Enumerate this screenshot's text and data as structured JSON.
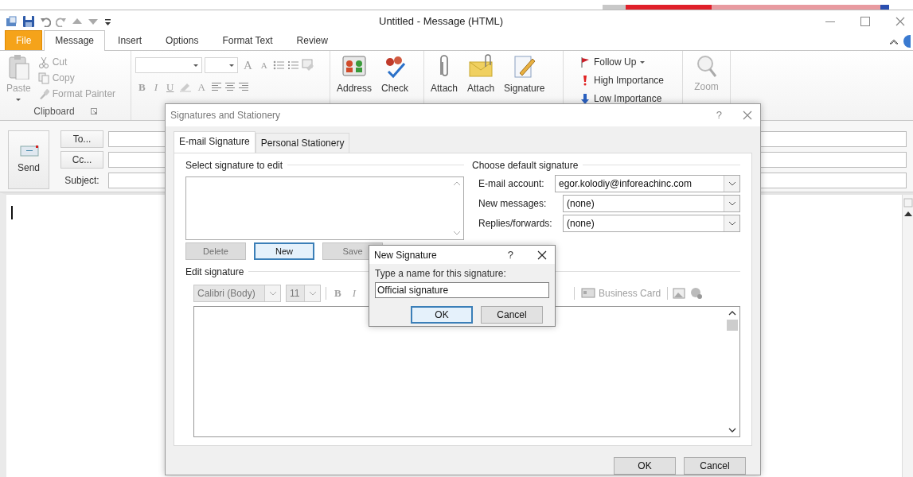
{
  "window": {
    "title": "Untitled - Message (HTML)"
  },
  "ribbon_tabs": [
    {
      "label": "File",
      "kind": "file",
      "selected": false
    },
    {
      "label": "Message",
      "kind": "tab",
      "selected": true
    },
    {
      "label": "Insert",
      "kind": "tab",
      "selected": false
    },
    {
      "label": "Options",
      "kind": "tab",
      "selected": false
    },
    {
      "label": "Format Text",
      "kind": "tab",
      "selected": false
    },
    {
      "label": "Review",
      "kind": "tab",
      "selected": false
    }
  ],
  "clipboard": {
    "paste": "Paste",
    "label": "Clipboard",
    "disabled": true,
    "items": [
      {
        "label": "Cut",
        "kind": "cut"
      },
      {
        "label": "Copy",
        "kind": "copy"
      },
      {
        "label": "Format Painter",
        "kind": "painter"
      }
    ]
  },
  "basic_text": {
    "grow": "A",
    "shrink": "A",
    "styles": [
      "B",
      "I",
      "U"
    ],
    "font_color": "A",
    "disabled": true
  },
  "big_buttons": [
    {
      "label": "Address",
      "kind": "address-book"
    },
    {
      "label": "Check",
      "kind": "check-names"
    },
    {
      "label": "Attach",
      "kind": "attach-file"
    },
    {
      "label": "Attach",
      "kind": "attach-item"
    },
    {
      "label": "Signature",
      "kind": "signature"
    }
  ],
  "tags": [
    {
      "label": "Follow Up",
      "kind": "flag"
    },
    {
      "label": "High Importance",
      "kind": "high"
    },
    {
      "label": "Low Importance",
      "kind": "low"
    }
  ],
  "zoom": {
    "label": "Zoom",
    "disabled": true
  },
  "message": {
    "send": "Send",
    "to": "To...",
    "cc": "Cc...",
    "subject": "Subject:"
  },
  "signatures_dialog": {
    "title": "Signatures and Stationery",
    "help": "?",
    "tabs": [
      {
        "label": "E-mail Signature",
        "selected": true
      },
      {
        "label": "Personal Stationery",
        "selected": false
      }
    ],
    "select_label": "Select signature to edit",
    "list_buttons": [
      {
        "label": "Delete",
        "disabled": true,
        "focused": false
      },
      {
        "label": "New",
        "disabled": false,
        "focused": true
      },
      {
        "label": "Save",
        "disabled": true,
        "focused": false
      }
    ],
    "default_label": "Choose default signature",
    "defaults": [
      {
        "label": "E-mail account:",
        "value": "egor.kolodiy@inforeachinc.com"
      },
      {
        "label": "New messages:",
        "value": "(none)"
      },
      {
        "label": "Replies/forwards:",
        "value": "(none)"
      }
    ],
    "edit_label": "Edit signature",
    "font": "Calibri (Body)",
    "size": "11",
    "styles": [
      "B",
      "I"
    ],
    "business_card": "Business Card",
    "buttons": [
      "OK",
      "Cancel"
    ]
  },
  "new_signature": {
    "title": "New Signature",
    "help": "?",
    "prompt": "Type a name for this signature:",
    "value": "Official signature",
    "buttons": [
      {
        "label": "OK",
        "focused": true
      },
      {
        "label": "Cancel",
        "focused": false
      }
    ]
  }
}
